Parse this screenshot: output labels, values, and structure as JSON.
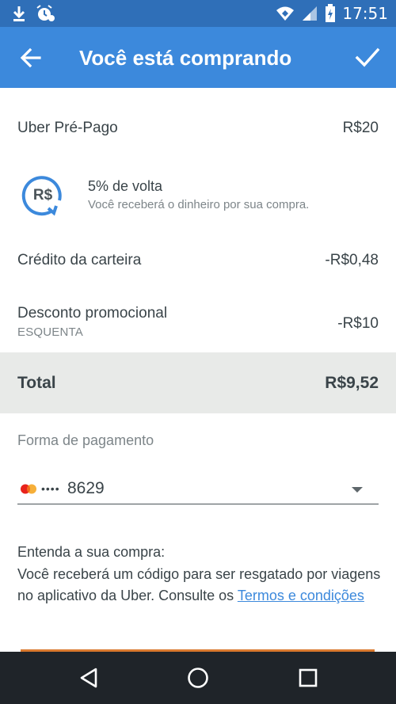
{
  "status_bar": {
    "time": "17:51",
    "icons": [
      "download-icon",
      "alarm-icon",
      "wifi-icon",
      "signal-icon",
      "battery-charging-icon"
    ]
  },
  "app_bar": {
    "title": "Você está comprando",
    "back_icon": "arrow-back-icon",
    "confirm_icon": "check-icon"
  },
  "purchase": {
    "item": {
      "label": "Uber Pré-Pago",
      "value": "R$20"
    },
    "cashback": {
      "icon_text": "R$",
      "title": "5% de volta",
      "description": "Você receberá o dinheiro por sua compra."
    },
    "wallet_credit": {
      "label": "Crédito da carteira",
      "value": "-R$0,48"
    },
    "promo_discount": {
      "label": "Desconto promocional",
      "code": "ESQUENTA",
      "value": "-R$10"
    },
    "total": {
      "label": "Total",
      "value": "R$9,52"
    }
  },
  "payment": {
    "header": "Forma de pagamento",
    "card_dots": "••••",
    "card_last4": "8629",
    "card_brand_icon": "mastercard-icon"
  },
  "info": {
    "line1": "Entenda a sua compra:",
    "body": "Você receberá um código para ser resgatado por viagens no aplicativo da Uber. Consulte os ",
    "link": "Termos e condições"
  },
  "colors": {
    "status_bar": "#2f6fb8",
    "app_bar": "#3c89dc",
    "total_band": "#e8eae8",
    "link": "#3c89dc",
    "nav_bar": "#1f2429",
    "accent_strip": "#d9792e"
  },
  "nav_bar": {
    "buttons": [
      "back-triangle-icon",
      "home-circle-icon",
      "recents-square-icon"
    ]
  }
}
